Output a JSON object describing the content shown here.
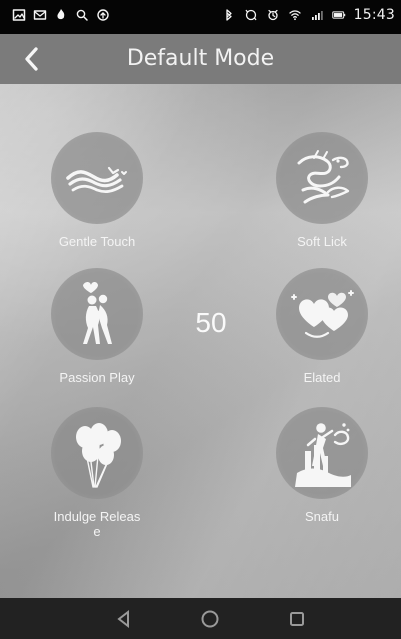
{
  "status_bar": {
    "time": "15:43",
    "icons": [
      "image-icon",
      "mail-icon",
      "flame-icon",
      "search-icon",
      "refresh-icon",
      "bluetooth-icon",
      "sync-icon",
      "alarm-icon",
      "wifi-icon",
      "signal-icon",
      "battery-icon"
    ]
  },
  "header": {
    "title": "Default Mode",
    "back_icon": "chevron-left-icon"
  },
  "modes": [
    {
      "label": "Gentle Touch",
      "icon": "wave-icon"
    },
    {
      "label": "Soft Lick",
      "icon": "dragon-icon"
    },
    {
      "label": "Passion Play",
      "icon": "couple-icon"
    },
    {
      "label": "Elated",
      "icon": "hearts-icon"
    },
    {
      "label": "Indulge Releas\ne",
      "icon": "balloons-icon"
    },
    {
      "label": "Snafu",
      "icon": "person-icon"
    }
  ],
  "level": {
    "value": "50"
  },
  "navigation": {
    "icons": [
      "back-icon",
      "home-icon",
      "recent-apps-icon"
    ]
  },
  "colors": {
    "status_bar": "#050505",
    "header": "#7b7b7b",
    "background_light": "#c8c8c8",
    "background_dark": "#a2a2a2",
    "circle": "#8a8a8a",
    "text": "#f4f4f4",
    "navbar": "#222222"
  }
}
